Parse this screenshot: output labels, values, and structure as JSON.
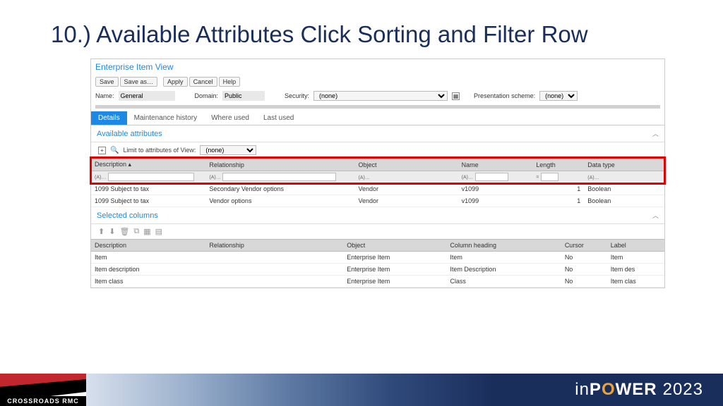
{
  "slide": {
    "title": "10.) Available Attributes Click Sorting and Filter Row"
  },
  "app": {
    "title": "Enterprise Item View",
    "buttons": {
      "save": "Save",
      "saveas": "Save as…",
      "apply": "Apply",
      "cancel": "Cancel",
      "help": "Help"
    },
    "form": {
      "name_lbl": "Name:",
      "name_val": "General",
      "domain_lbl": "Domain:",
      "domain_val": "Public",
      "security_lbl": "Security:",
      "security_val": "(none)",
      "scheme_lbl": "Presentation scheme:",
      "scheme_val": "(none)"
    },
    "tabs": {
      "details": "Details",
      "maint": "Maintenance history",
      "where": "Where used",
      "last": "Last used"
    },
    "avail": {
      "title": "Available attributes",
      "limit_lbl": "Limit to attributes of View:",
      "limit_val": "(none)",
      "headers": {
        "desc": "Description ▴",
        "rel": "Relationship",
        "obj": "Object",
        "name": "Name",
        "len": "Length",
        "dtype": "Data type"
      },
      "filter_hint": "(A)…",
      "rows": [
        {
          "desc": "1099 Subject to tax",
          "rel": "Secondary Vendor options",
          "obj": "Vendor",
          "name": "v1099",
          "len": "1",
          "dtype": "Boolean"
        },
        {
          "desc": "1099 Subject to tax",
          "rel": "Vendor options",
          "obj": "Vendor",
          "name": "v1099",
          "len": "1",
          "dtype": "Boolean"
        }
      ]
    },
    "selcols": {
      "title": "Selected columns",
      "headers": {
        "desc": "Description",
        "rel": "Relationship",
        "obj": "Object",
        "colh": "Column heading",
        "cursor": "Cursor",
        "label": "Label"
      },
      "rows": [
        {
          "desc": "Item",
          "rel": "",
          "obj": "Enterprise Item",
          "colh": "Item",
          "cursor": "No",
          "label": "Item"
        },
        {
          "desc": "Item description",
          "rel": "",
          "obj": "Enterprise Item",
          "colh": "Item Description",
          "cursor": "No",
          "label": "Item des"
        },
        {
          "desc": "Item class",
          "rel": "",
          "obj": "Enterprise Item",
          "colh": "Class",
          "cursor": "No",
          "label": "Item clas"
        }
      ]
    }
  },
  "footer": {
    "logo_text": "CROSSROADS RMC",
    "brand_in": "in",
    "brand_p": "P",
    "brand_o": "O",
    "brand_wer": "WER",
    "year": "2023"
  }
}
